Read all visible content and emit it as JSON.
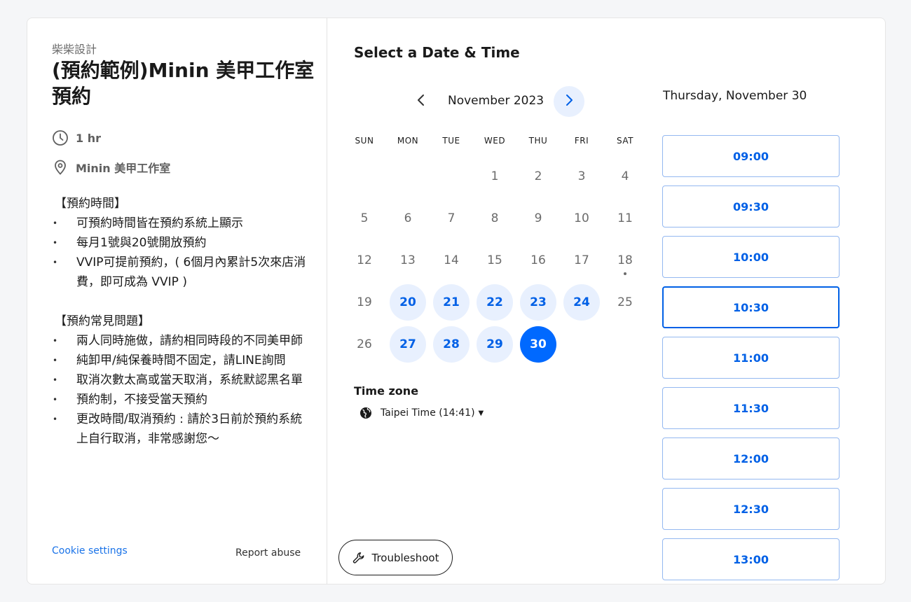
{
  "organizer": "柴柴設計",
  "event_title": "(預約範例)Minin 美甲工作室預約",
  "duration": "1 hr",
  "location": "Minin 美甲工作室",
  "description": {
    "section1_title": "【預約時間】",
    "section1_items": [
      "可預約時間皆在預約系統上顯示",
      "每月1號與20號開放預約",
      "VVIP可提前預約，( 6個月內累計5次來店消費，即可成為 VVIP )"
    ],
    "section2_title": "【預約常見問題】",
    "section2_items": [
      "兩人同時施做，請約相同時段的不同美甲師",
      "純卸甲/純保養時間不固定，請LINE詢問",
      "取消次數太高或當天取消，系統默認黑名單",
      "預約制，不接受當天預約",
      "更改時間/取消預約 : 請於3日前於預約系統上自行取消，非常感謝您～"
    ]
  },
  "footer": {
    "cookie": "Cookie settings",
    "report": "Report abuse"
  },
  "calendar": {
    "heading": "Select a Date & Time",
    "month": "November 2023",
    "weekdays": [
      "SUN",
      "MON",
      "TUE",
      "WED",
      "THU",
      "FRI",
      "SAT"
    ],
    "weeks": [
      [
        "",
        "",
        "",
        "1",
        "2",
        "3",
        "4"
      ],
      [
        "5",
        "6",
        "7",
        "8",
        "9",
        "10",
        "11"
      ],
      [
        "12",
        "13",
        "14",
        "15",
        "16",
        "17",
        "18"
      ],
      [
        "19",
        "20",
        "21",
        "22",
        "23",
        "24",
        "25"
      ],
      [
        "26",
        "27",
        "28",
        "29",
        "30",
        "",
        ""
      ]
    ],
    "available": [
      "20",
      "21",
      "22",
      "23",
      "24",
      "27",
      "28",
      "29"
    ],
    "selected": "30",
    "today": "18"
  },
  "timezone": {
    "label": "Time zone",
    "value": "Taipei Time (14:41)"
  },
  "troubleshoot": "Troubleshoot",
  "selected_date_label": "Thursday, November 30",
  "time_slots": [
    "09:00",
    "09:30",
    "10:00",
    "10:30",
    "11:00",
    "11:30",
    "12:00",
    "12:30",
    "13:00"
  ],
  "active_slot": "10:30",
  "colors": {
    "accent": "#0069ff",
    "accent_light": "#e8f0fe",
    "link": "#1a73e8"
  }
}
